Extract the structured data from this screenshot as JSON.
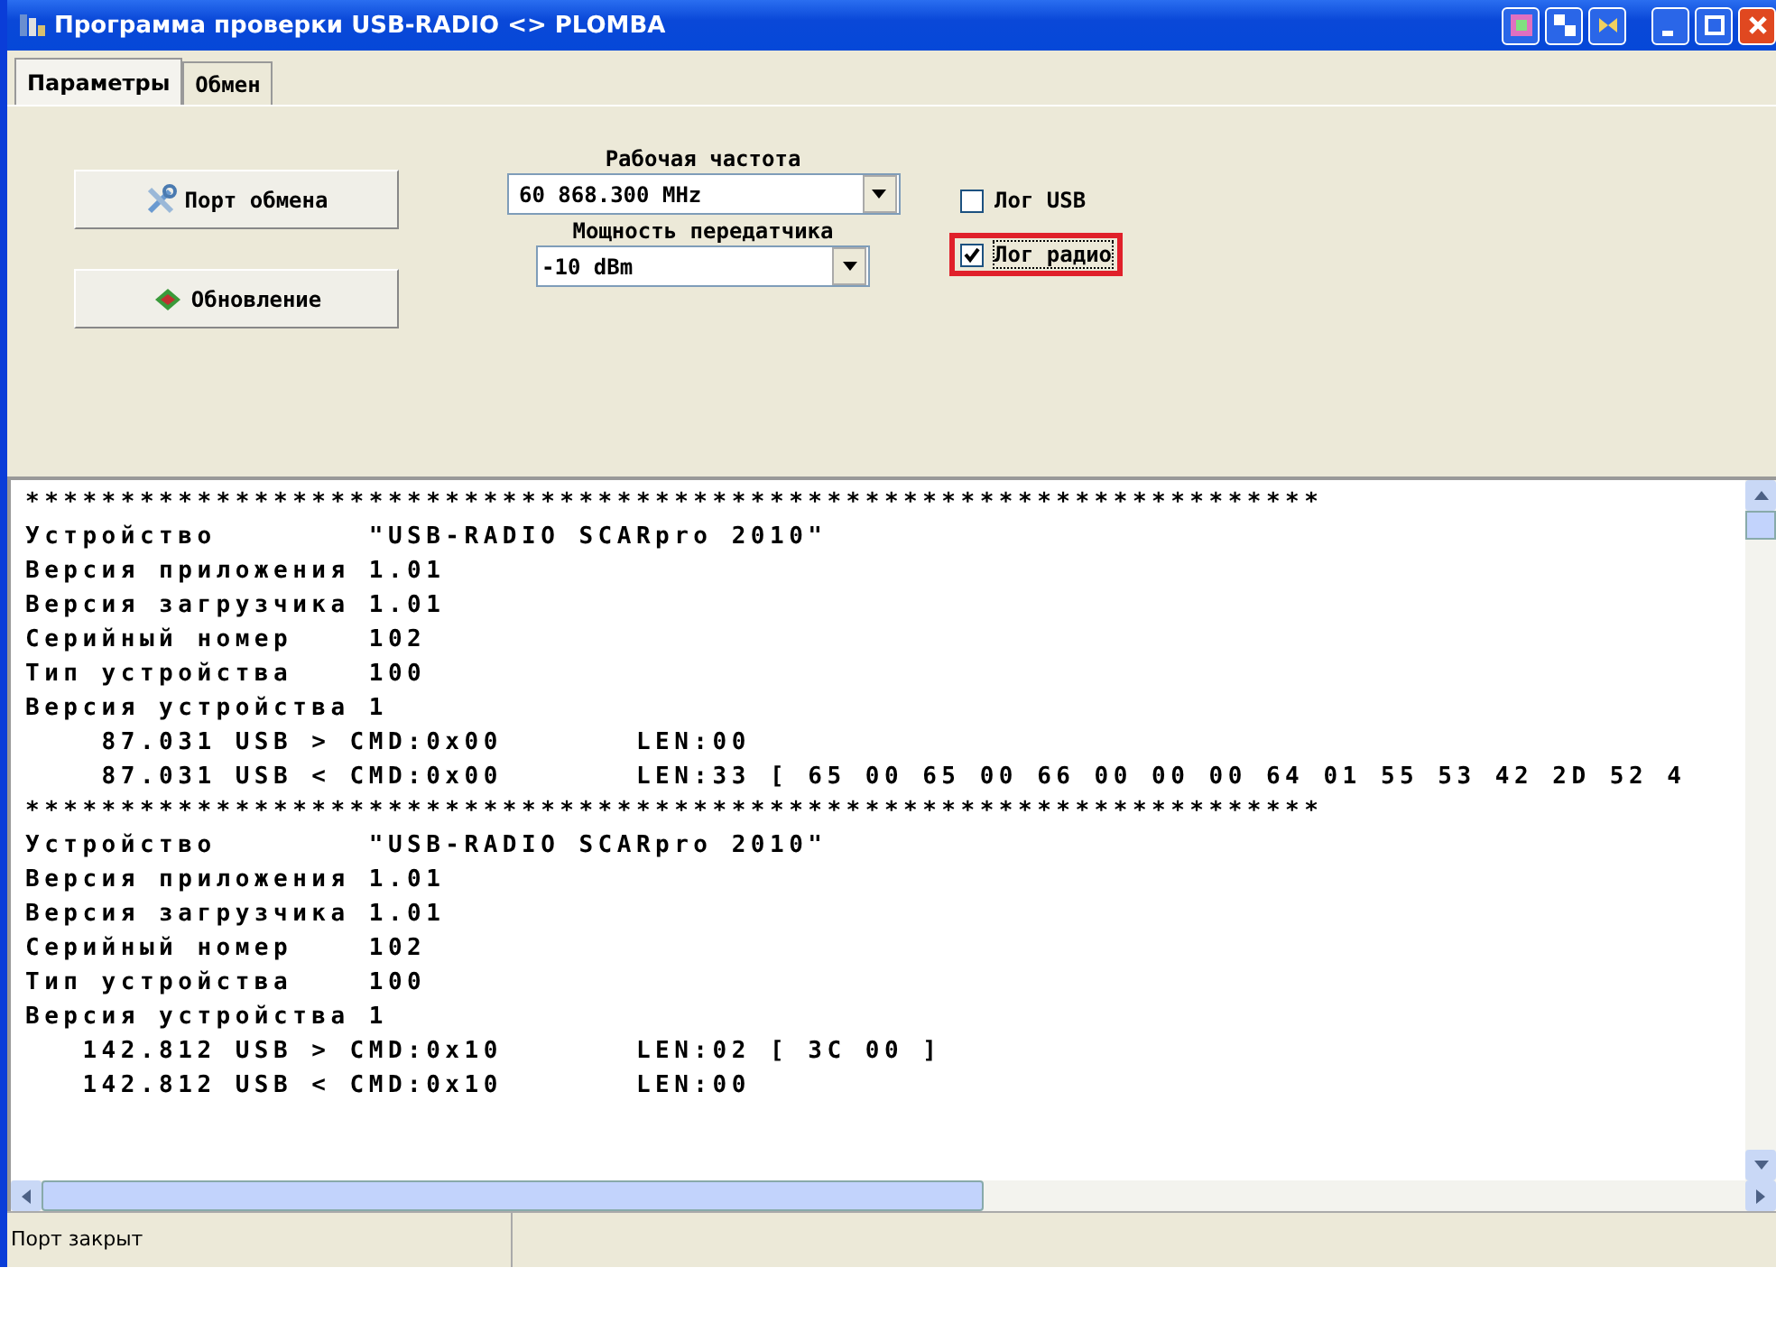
{
  "window": {
    "title": "Программа проверки USB-RADIO <> PLOMBA"
  },
  "tabs": [
    {
      "label": "Параметры",
      "selected": true
    },
    {
      "label": "Обмен",
      "selected": false
    }
  ],
  "buttons": [
    {
      "label": "Порт обмена",
      "kind": "tools"
    },
    {
      "label": "Обновление",
      "kind": "chip"
    }
  ],
  "frequency": {
    "label": "Рабочая частота",
    "value": "60 868.300 MHz"
  },
  "power": {
    "label": "Мощность передатчика",
    "value": "-10 dBm"
  },
  "checkboxes": [
    {
      "label": "Лог USB",
      "checked": false,
      "highlighted": false
    },
    {
      "label": "Лог радио",
      "checked": true,
      "highlighted": true
    }
  ],
  "log": [
    "********************************************************************",
    "Устройство        \"USB-RADIO SCARpro 2010\"",
    "Версия приложения 1.01",
    "Версия загрузчика 1.01",
    "Серийный номер    102",
    "Тип устройства    100",
    "Версия устройства 1",
    "    87.031 USB > CMD:0x00       LEN:00",
    "    87.031 USB < CMD:0x00       LEN:33 [ 65 00 65 00 66 00 00 00 64 01 55 53 42 2D 52 4",
    "********************************************************************",
    "Устройство        \"USB-RADIO SCARpro 2010\"",
    "Версия приложения 1.01",
    "Версия загрузчика 1.01",
    "Серийный номер    102",
    "Тип устройства    100",
    "Версия устройства 1",
    "   142.812 USB > CMD:0x10       LEN:02 [ 3C 00 ]",
    "   142.812 USB < CMD:0x10       LEN:00"
  ],
  "status_bar": {
    "text": "Порт закрыт"
  }
}
